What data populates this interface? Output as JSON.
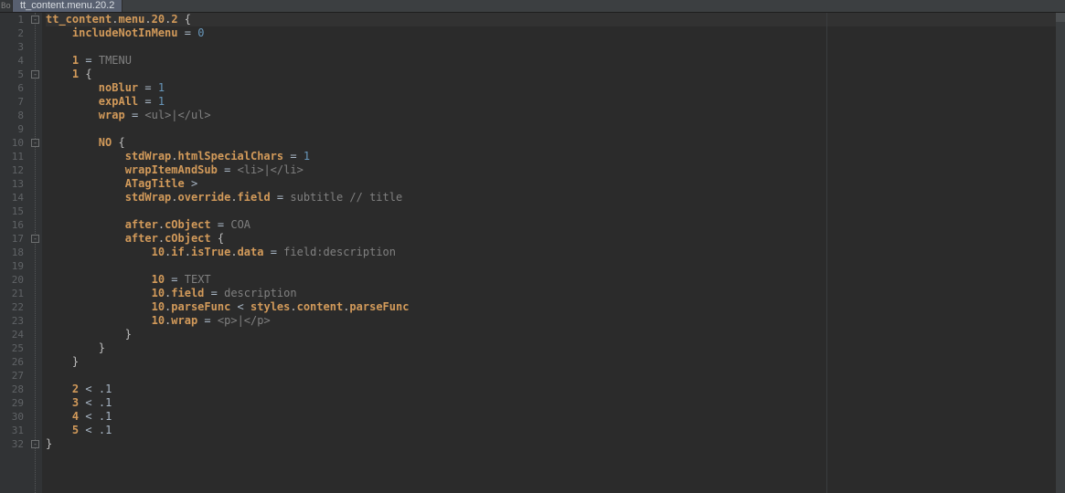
{
  "tab_bar": {
    "prefix": "Bo",
    "tab_title": "tt_content.menu.20.2"
  },
  "fold_markers": [
    {
      "line": 1,
      "type": "open"
    },
    {
      "line": 5,
      "type": "open"
    },
    {
      "line": 10,
      "type": "open"
    },
    {
      "line": 17,
      "type": "open"
    },
    {
      "line": 32,
      "type": "close"
    }
  ],
  "code": {
    "lines": [
      [
        [
          "key",
          "tt_content"
        ],
        [
          "punc",
          "."
        ],
        [
          "key",
          "menu"
        ],
        [
          "punc",
          "."
        ],
        [
          "key",
          "20"
        ],
        [
          "punc",
          "."
        ],
        [
          "key",
          "2"
        ],
        [
          "sp",
          " "
        ],
        [
          "punc",
          "{"
        ]
      ],
      [
        [
          "pad",
          "    "
        ],
        [
          "key",
          "includeNotInMenu"
        ],
        [
          "sp",
          " "
        ],
        [
          "eq",
          "="
        ],
        [
          "sp",
          " "
        ],
        [
          "num",
          "0"
        ]
      ],
      [],
      [
        [
          "pad",
          "    "
        ],
        [
          "key",
          "1"
        ],
        [
          "sp",
          " "
        ],
        [
          "eq",
          "="
        ],
        [
          "sp",
          " "
        ],
        [
          "val",
          "TMENU"
        ]
      ],
      [
        [
          "pad",
          "    "
        ],
        [
          "key",
          "1"
        ],
        [
          "sp",
          " "
        ],
        [
          "punc",
          "{"
        ]
      ],
      [
        [
          "pad",
          "        "
        ],
        [
          "key",
          "noBlur"
        ],
        [
          "sp",
          " "
        ],
        [
          "eq",
          "="
        ],
        [
          "sp",
          " "
        ],
        [
          "num",
          "1"
        ]
      ],
      [
        [
          "pad",
          "        "
        ],
        [
          "key",
          "expAll"
        ],
        [
          "sp",
          " "
        ],
        [
          "eq",
          "="
        ],
        [
          "sp",
          " "
        ],
        [
          "num",
          "1"
        ]
      ],
      [
        [
          "pad",
          "        "
        ],
        [
          "key",
          "wrap"
        ],
        [
          "sp",
          " "
        ],
        [
          "eq",
          "="
        ],
        [
          "sp",
          " "
        ],
        [
          "val",
          "<ul>|</ul>"
        ]
      ],
      [],
      [
        [
          "pad",
          "        "
        ],
        [
          "key",
          "NO"
        ],
        [
          "sp",
          " "
        ],
        [
          "punc",
          "{"
        ]
      ],
      [
        [
          "pad",
          "            "
        ],
        [
          "key",
          "stdWrap"
        ],
        [
          "punc",
          "."
        ],
        [
          "key",
          "htmlSpecialChars"
        ],
        [
          "sp",
          " "
        ],
        [
          "eq",
          "="
        ],
        [
          "sp",
          " "
        ],
        [
          "num",
          "1"
        ]
      ],
      [
        [
          "pad",
          "            "
        ],
        [
          "key",
          "wrapItemAndSub"
        ],
        [
          "sp",
          " "
        ],
        [
          "eq",
          "="
        ],
        [
          "sp",
          " "
        ],
        [
          "val",
          "<li>|</li>"
        ]
      ],
      [
        [
          "pad",
          "            "
        ],
        [
          "key",
          "ATagTitle"
        ],
        [
          "sp",
          " "
        ],
        [
          "op",
          ">"
        ]
      ],
      [
        [
          "pad",
          "            "
        ],
        [
          "key",
          "stdWrap"
        ],
        [
          "punc",
          "."
        ],
        [
          "key",
          "override"
        ],
        [
          "punc",
          "."
        ],
        [
          "key",
          "field"
        ],
        [
          "sp",
          " "
        ],
        [
          "eq",
          "="
        ],
        [
          "sp",
          " "
        ],
        [
          "val",
          "subtitle // title"
        ]
      ],
      [],
      [
        [
          "pad",
          "            "
        ],
        [
          "key",
          "after"
        ],
        [
          "punc",
          "."
        ],
        [
          "key",
          "cObject"
        ],
        [
          "sp",
          " "
        ],
        [
          "eq",
          "="
        ],
        [
          "sp",
          " "
        ],
        [
          "val",
          "COA"
        ]
      ],
      [
        [
          "pad",
          "            "
        ],
        [
          "key",
          "after"
        ],
        [
          "punc",
          "."
        ],
        [
          "key",
          "cObject"
        ],
        [
          "sp",
          " "
        ],
        [
          "punc",
          "{"
        ]
      ],
      [
        [
          "pad",
          "                "
        ],
        [
          "key",
          "10"
        ],
        [
          "punc",
          "."
        ],
        [
          "key",
          "if"
        ],
        [
          "punc",
          "."
        ],
        [
          "key",
          "isTrue"
        ],
        [
          "punc",
          "."
        ],
        [
          "key",
          "data"
        ],
        [
          "sp",
          " "
        ],
        [
          "eq",
          "="
        ],
        [
          "sp",
          " "
        ],
        [
          "val",
          "field:description"
        ]
      ],
      [],
      [
        [
          "pad",
          "                "
        ],
        [
          "key",
          "10"
        ],
        [
          "sp",
          " "
        ],
        [
          "eq",
          "="
        ],
        [
          "sp",
          " "
        ],
        [
          "val",
          "TEXT"
        ]
      ],
      [
        [
          "pad",
          "                "
        ],
        [
          "key",
          "10"
        ],
        [
          "punc",
          "."
        ],
        [
          "key",
          "field"
        ],
        [
          "sp",
          " "
        ],
        [
          "eq",
          "="
        ],
        [
          "sp",
          " "
        ],
        [
          "val",
          "description"
        ]
      ],
      [
        [
          "pad",
          "                "
        ],
        [
          "key",
          "10"
        ],
        [
          "punc",
          "."
        ],
        [
          "key",
          "parseFunc"
        ],
        [
          "sp",
          " "
        ],
        [
          "op",
          "<"
        ],
        [
          "sp",
          " "
        ],
        [
          "key",
          "styles"
        ],
        [
          "punc",
          "."
        ],
        [
          "key",
          "content"
        ],
        [
          "punc",
          "."
        ],
        [
          "key",
          "parseFunc"
        ]
      ],
      [
        [
          "pad",
          "                "
        ],
        [
          "key",
          "10"
        ],
        [
          "punc",
          "."
        ],
        [
          "key",
          "wrap"
        ],
        [
          "sp",
          " "
        ],
        [
          "eq",
          "="
        ],
        [
          "sp",
          " "
        ],
        [
          "val",
          "<p>|</p>"
        ]
      ],
      [
        [
          "pad",
          "            "
        ],
        [
          "punc",
          "}"
        ]
      ],
      [
        [
          "pad",
          "        "
        ],
        [
          "punc",
          "}"
        ]
      ],
      [
        [
          "pad",
          "    "
        ],
        [
          "punc",
          "}"
        ]
      ],
      [],
      [
        [
          "pad",
          "    "
        ],
        [
          "key",
          "2"
        ],
        [
          "sp",
          " "
        ],
        [
          "op",
          "<"
        ],
        [
          "sp",
          " "
        ],
        [
          "ref",
          ".1"
        ]
      ],
      [
        [
          "pad",
          "    "
        ],
        [
          "key",
          "3"
        ],
        [
          "sp",
          " "
        ],
        [
          "op",
          "<"
        ],
        [
          "sp",
          " "
        ],
        [
          "ref",
          ".1"
        ]
      ],
      [
        [
          "pad",
          "    "
        ],
        [
          "key",
          "4"
        ],
        [
          "sp",
          " "
        ],
        [
          "op",
          "<"
        ],
        [
          "sp",
          " "
        ],
        [
          "ref",
          ".1"
        ]
      ],
      [
        [
          "pad",
          "    "
        ],
        [
          "key",
          "5"
        ],
        [
          "sp",
          " "
        ],
        [
          "op",
          "<"
        ],
        [
          "sp",
          " "
        ],
        [
          "ref",
          ".1"
        ]
      ],
      [
        [
          "punc",
          "}"
        ]
      ]
    ],
    "highlight_line": 1,
    "total_lines": 32
  }
}
